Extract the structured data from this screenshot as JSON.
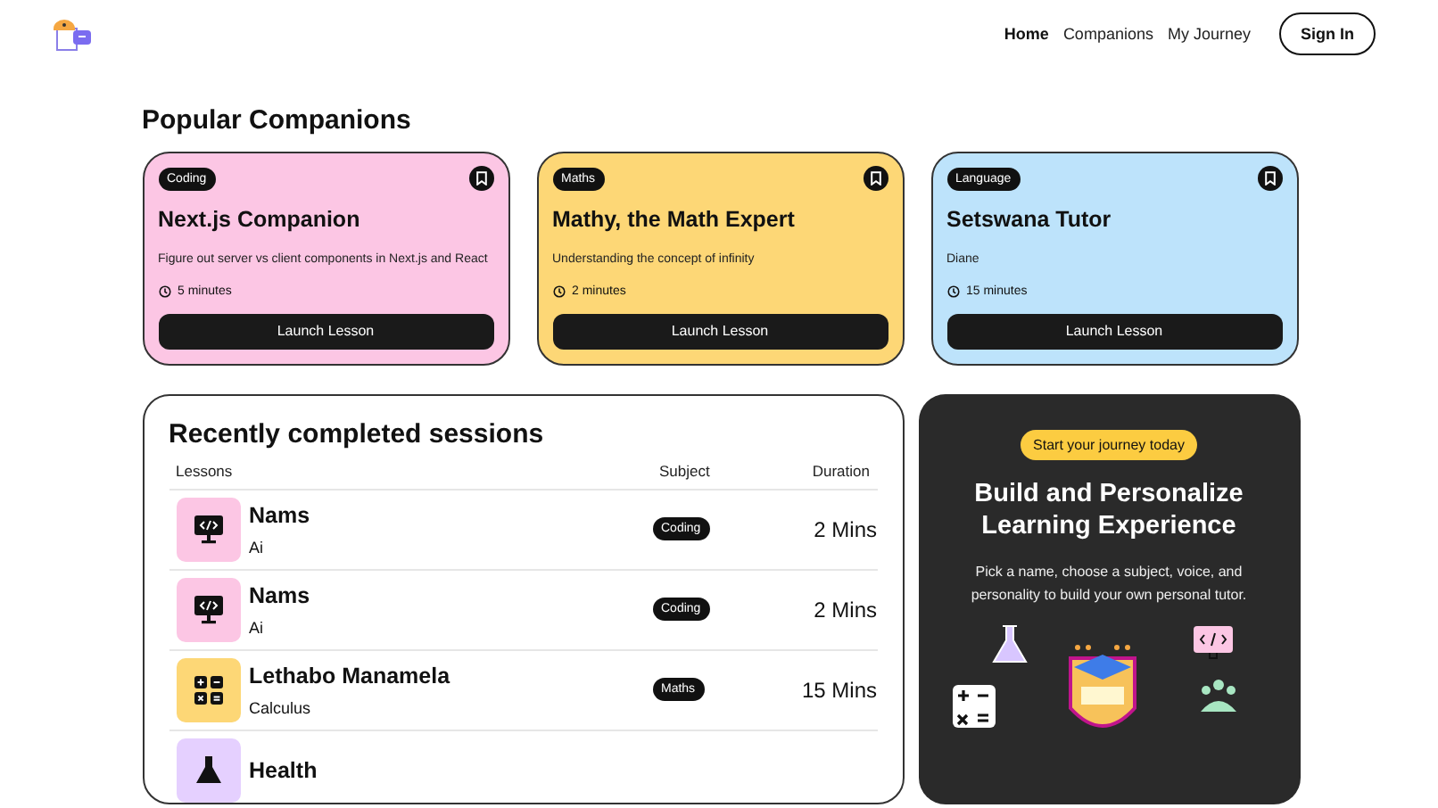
{
  "header": {
    "nav": [
      {
        "label": "Home",
        "selected": true
      },
      {
        "label": "Companions",
        "selected": false
      },
      {
        "label": "My Journey",
        "selected": false
      }
    ],
    "sign_in": "Sign In"
  },
  "popular": {
    "title": "Popular Companions",
    "companions": [
      {
        "subject": "Coding",
        "name": "Next.js Companion",
        "topic": "Figure out server vs client components in Next.js and React",
        "duration": "5 minutes",
        "color": "#fcc6e4",
        "button": "Launch Lesson"
      },
      {
        "subject": "Maths",
        "name": "Mathy, the Math Expert",
        "topic": "Understanding the concept of infinity",
        "duration": "2 minutes",
        "color": "#fdd776",
        "button": "Launch Lesson"
      },
      {
        "subject": "Language",
        "name": "Setswana Tutor",
        "topic": "Diane",
        "duration": "15 minutes",
        "color": "#bde3fb",
        "button": "Launch Lesson"
      }
    ]
  },
  "sessions": {
    "title": "Recently completed sessions",
    "columns": [
      "Lessons",
      "Subject",
      "Duration"
    ],
    "rows": [
      {
        "kind": "coding",
        "color": "#fcc6e4",
        "name": "Nams",
        "topic": "Ai",
        "subject": "Coding",
        "duration": "2 Mins"
      },
      {
        "kind": "coding",
        "color": "#fcc6e4",
        "name": "Nams",
        "topic": "Ai",
        "subject": "Coding",
        "duration": "2 Mins"
      },
      {
        "kind": "maths",
        "color": "#fdd776",
        "name": "Lethabo Manamela",
        "topic": "Calculus",
        "subject": "Maths",
        "duration": "15 Mins"
      },
      {
        "kind": "science",
        "color": "#e5d0ff",
        "name": "Health"
      }
    ]
  },
  "cta": {
    "badge": "Start your journey today",
    "title": "Build and Personalize Learning Experience",
    "text": "Pick a name, choose a subject, voice, and personality to build your own personal tutor."
  }
}
